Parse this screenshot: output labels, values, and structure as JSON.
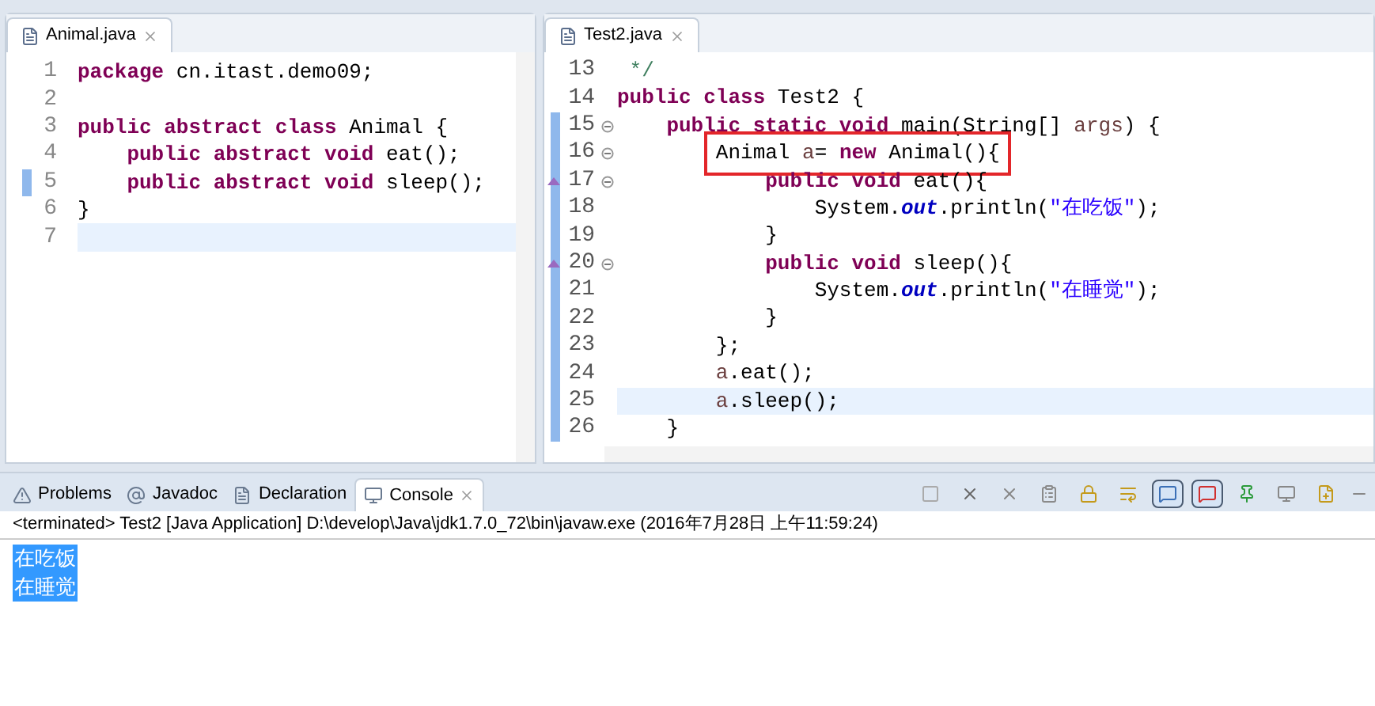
{
  "editors": [
    {
      "tab": {
        "label": "Animal.java",
        "selected": true
      },
      "lines": [
        {
          "n": "1",
          "tokens": [
            {
              "text": "package",
              "kind": "kw"
            },
            {
              "text": " cn.itast.demo09;",
              "kind": "plain"
            }
          ],
          "current": false,
          "changed": false,
          "fold": false,
          "override": false,
          "boxed": false
        },
        {
          "n": "2",
          "current": false,
          "changed": false,
          "fold": false,
          "override": false,
          "boxed": false
        },
        {
          "n": "3",
          "tokens": [
            {
              "text": "public abstract class",
              "kind": "kw"
            },
            {
              "text": " Animal {",
              "kind": "plain"
            }
          ],
          "current": false,
          "changed": false,
          "fold": false,
          "override": false,
          "boxed": false
        },
        {
          "n": "4",
          "tokens": [
            {
              "text": "    public abstract void",
              "kind": "kw"
            },
            {
              "text": " eat();",
              "kind": "plain"
            }
          ],
          "current": false,
          "changed": false,
          "fold": false,
          "override": false,
          "boxed": false
        },
        {
          "n": "5",
          "tokens": [
            {
              "text": "    public abstract void",
              "kind": "kw"
            },
            {
              "text": " sleep();",
              "kind": "plain"
            }
          ],
          "current": false,
          "changed": true,
          "fold": false,
          "override": false,
          "boxed": false
        },
        {
          "n": "6",
          "tokens": [
            {
              "text": "}",
              "kind": "plain"
            }
          ],
          "current": false,
          "changed": false,
          "fold": false,
          "override": false,
          "boxed": false
        },
        {
          "n": "7",
          "current": true,
          "changed": false,
          "fold": false,
          "override": false,
          "boxed": false
        }
      ]
    },
    {
      "tab": {
        "label": "Test2.java",
        "selected": true
      },
      "lines": [
        {
          "n": "13",
          "tokens": [
            {
              "text": " */",
              "kind": "comment"
            }
          ],
          "current": false,
          "changed": false,
          "fold": false,
          "override": false,
          "boxed": false
        },
        {
          "n": "14",
          "tokens": [
            {
              "text": "public class",
              "kind": "kw"
            },
            {
              "text": " Test2 {",
              "kind": "plain"
            }
          ],
          "current": false,
          "changed": false,
          "fold": false,
          "override": false,
          "boxed": false
        },
        {
          "n": "15",
          "tokens": [
            {
              "text": "    public static void",
              "kind": "kw"
            },
            {
              "text": " main(String[] ",
              "kind": "plain"
            },
            {
              "text": "args",
              "kind": "var"
            },
            {
              "text": ") {",
              "kind": "plain"
            }
          ],
          "current": false,
          "changed": true,
          "fold": true,
          "override": false,
          "boxed": false
        },
        {
          "n": "16",
          "tokens": [
            {
              "text": "        Animal ",
              "kind": "plain"
            },
            {
              "text": "a",
              "kind": "var"
            },
            {
              "text": "= ",
              "kind": "plain"
            },
            {
              "text": "new",
              "kind": "kw"
            },
            {
              "text": " Animal(){",
              "kind": "plain"
            }
          ],
          "current": false,
          "changed": true,
          "fold": true,
          "override": false,
          "boxed": true
        },
        {
          "n": "17",
          "tokens": [
            {
              "text": "            public void",
              "kind": "kw"
            },
            {
              "text": " eat(){",
              "kind": "plain"
            }
          ],
          "current": false,
          "changed": true,
          "fold": true,
          "override": true,
          "boxed": false
        },
        {
          "n": "18",
          "tokens": [
            {
              "text": "                System.",
              "kind": "plain"
            },
            {
              "text": "out",
              "kind": "field"
            },
            {
              "text": ".println(",
              "kind": "plain"
            },
            {
              "text": "\"在吃饭\"",
              "kind": "str"
            },
            {
              "text": ");",
              "kind": "plain"
            }
          ],
          "current": false,
          "changed": true,
          "fold": false,
          "override": false,
          "boxed": false
        },
        {
          "n": "19",
          "tokens": [
            {
              "text": "            }",
              "kind": "plain"
            }
          ],
          "current": false,
          "changed": true,
          "fold": false,
          "override": false,
          "boxed": false
        },
        {
          "n": "20",
          "tokens": [
            {
              "text": "            public void",
              "kind": "kw"
            },
            {
              "text": " sleep(){",
              "kind": "plain"
            }
          ],
          "current": false,
          "changed": true,
          "fold": true,
          "override": true,
          "boxed": false
        },
        {
          "n": "21",
          "tokens": [
            {
              "text": "                System.",
              "kind": "plain"
            },
            {
              "text": "out",
              "kind": "field"
            },
            {
              "text": ".println(",
              "kind": "plain"
            },
            {
              "text": "\"在睡觉\"",
              "kind": "str"
            },
            {
              "text": ");",
              "kind": "plain"
            }
          ],
          "current": false,
          "changed": true,
          "fold": false,
          "override": false,
          "boxed": false
        },
        {
          "n": "22",
          "tokens": [
            {
              "text": "            }",
              "kind": "plain"
            }
          ],
          "current": false,
          "changed": true,
          "fold": false,
          "override": false,
          "boxed": false
        },
        {
          "n": "23",
          "tokens": [
            {
              "text": "        };",
              "kind": "plain"
            }
          ],
          "current": false,
          "changed": true,
          "fold": false,
          "override": false,
          "boxed": false
        },
        {
          "n": "24",
          "tokens": [
            {
              "text": "        a",
              "kind": "var"
            },
            {
              "text": ".eat();",
              "kind": "plain"
            }
          ],
          "current": false,
          "changed": true,
          "fold": false,
          "override": false,
          "boxed": false
        },
        {
          "n": "25",
          "tokens": [
            {
              "text": "        a",
              "kind": "var"
            },
            {
              "text": ".sleep();",
              "kind": "plain"
            }
          ],
          "current": true,
          "changed": true,
          "fold": false,
          "override": false,
          "boxed": false
        },
        {
          "n": "26",
          "tokens": [
            {
              "text": "    }",
              "kind": "plain"
            }
          ],
          "current": false,
          "changed": true,
          "fold": false,
          "override": false,
          "boxed": false
        }
      ]
    }
  ],
  "bottom_tabs": [
    {
      "label": "Problems",
      "kind": "problems",
      "selected": false
    },
    {
      "label": "Javadoc",
      "kind": "javadoc",
      "selected": false
    },
    {
      "label": "Declaration",
      "kind": "declaration",
      "selected": false
    },
    {
      "label": "Console",
      "kind": "console",
      "selected": true
    }
  ],
  "console_toolbar": [
    {
      "kind": "stop",
      "selected": false
    },
    {
      "kind": "remove",
      "selected": false
    },
    {
      "kind": "remove-all",
      "selected": false
    },
    {
      "kind": "clear",
      "selected": false
    },
    {
      "kind": "lock",
      "selected": false
    },
    {
      "kind": "wrap",
      "selected": false
    },
    {
      "kind": "stdout",
      "selected": true
    },
    {
      "kind": "stderr",
      "selected": true
    },
    {
      "kind": "pin",
      "selected": false
    },
    {
      "kind": "display",
      "selected": false
    },
    {
      "kind": "open",
      "selected": false
    }
  ],
  "console": {
    "status": "<terminated> Test2 [Java Application] D:\\develop\\Java\\jdk1.7.0_72\\bin\\javaw.exe (2016年7月28日 上午11:59:24)",
    "output": [
      {
        "text": "在吃饭",
        "selected": true
      },
      {
        "text": "在睡觉",
        "selected": true
      }
    ]
  }
}
